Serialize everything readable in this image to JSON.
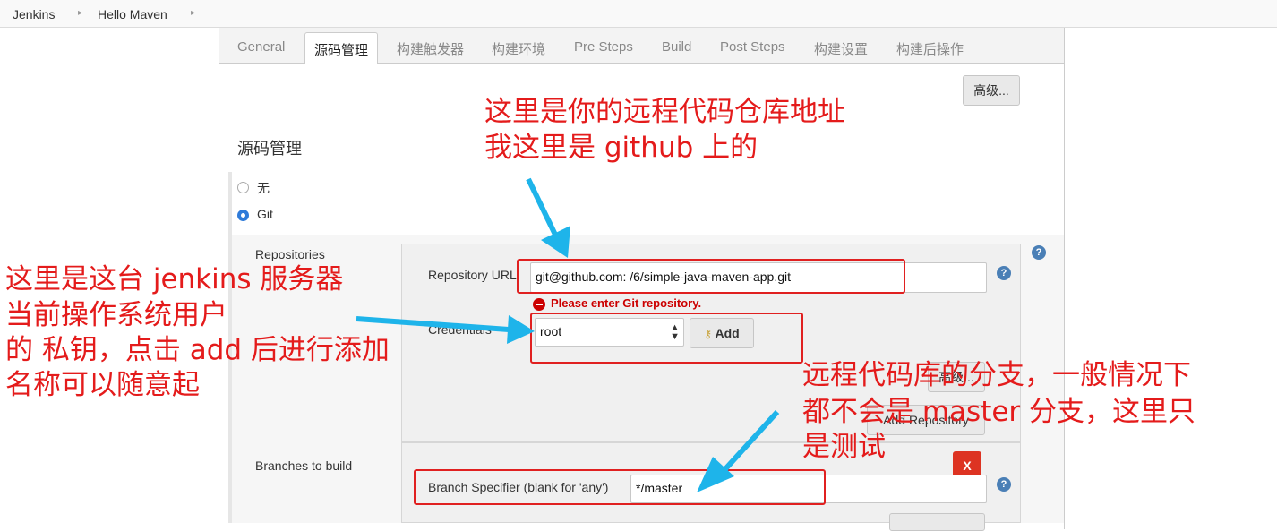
{
  "breadcrumb": {
    "root": "Jenkins",
    "job": "Hello Maven"
  },
  "tabs": [
    "General",
    "源码管理",
    "构建触发器",
    "构建环境",
    "Pre Steps",
    "Build",
    "Post Steps",
    "构建设置",
    "构建后操作"
  ],
  "advanced_label": "高级...",
  "scm": {
    "title": "源码管理",
    "option_none": "无",
    "option_git": "Git"
  },
  "repositories": {
    "label": "Repositories",
    "url_label": "Repository URL",
    "url_value": "git@github.com:          /6/simple-java-maven-app.git",
    "error": "Please enter Git repository.",
    "credentials_label": "Credentials",
    "credentials_value": "root",
    "add_label": "Add",
    "advanced_label": "高级...",
    "add_repo_label": "Add Repository"
  },
  "branches": {
    "label": "Branches to build",
    "specifier_label": "Branch Specifier (blank for 'any')",
    "specifier_value": "*/master",
    "delete_label": "X"
  },
  "help_icon": "?",
  "annotations": {
    "repo_lines": [
      "这里是你的远程代码仓库地址",
      "我这里是 github 上的"
    ],
    "cred_lines": [
      "这里是这台 jenkins 服务器",
      "当前操作系统用户",
      "的  私钥，点击 add 后进行添加",
      "名称可以随意起"
    ],
    "branch_lines": [
      "远程代码库的分支，一般情况下",
      "都不会是 master 分支，这里只",
      "是测试"
    ]
  },
  "colors": {
    "annotation": "#e41b1b",
    "arrow": "#1eb4ea",
    "error": "#cc0000"
  }
}
